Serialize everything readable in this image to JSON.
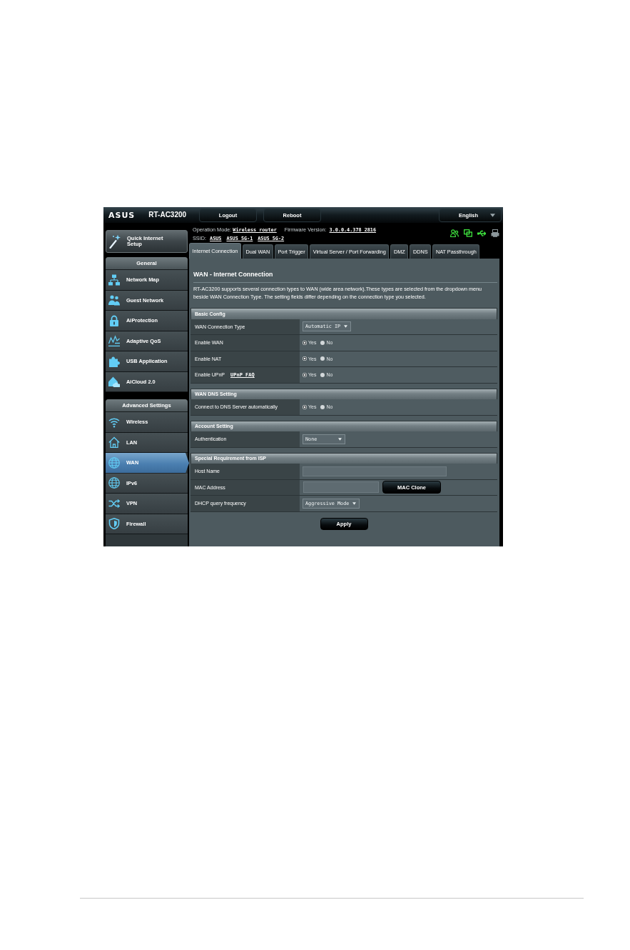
{
  "header": {
    "logo": "ASUS",
    "model": "RT-AC3200",
    "buttons": [
      "Logout",
      "Reboot"
    ],
    "language": "English"
  },
  "quick_setup": {
    "label": "Quick Internet Setup"
  },
  "status": {
    "operation_mode_label": "Operation Mode:",
    "operation_mode": "Wireless router",
    "firmware_label": "Firmware Version:",
    "firmware": "3.0.0.4.378_2816",
    "ssid_label": "SSID:",
    "ssids": [
      "ASUS",
      "ASUS_5G-1",
      "ASUS_5G-2"
    ],
    "icons": [
      {
        "kind": "clients",
        "on": true
      },
      {
        "kind": "network",
        "on": true
      },
      {
        "kind": "usb",
        "on": true
      },
      {
        "kind": "printer",
        "on": false
      }
    ]
  },
  "sidebar": {
    "sections": [
      {
        "title": "General",
        "items": [
          {
            "label": "Network Map",
            "selected": false
          },
          {
            "label": "Guest Network",
            "selected": false
          },
          {
            "label": "AiProtection",
            "selected": false
          },
          {
            "label": "Adaptive QoS",
            "selected": false
          },
          {
            "label": "USB Application",
            "selected": false
          },
          {
            "label": "AiCloud 2.0",
            "selected": false
          }
        ]
      },
      {
        "title": "Advanced Settings",
        "items": [
          {
            "label": "Wireless",
            "selected": false
          },
          {
            "label": "LAN",
            "selected": false
          },
          {
            "label": "WAN",
            "selected": true
          },
          {
            "label": "IPv6",
            "selected": false
          },
          {
            "label": "VPN",
            "selected": false
          },
          {
            "label": "Firewall",
            "selected": false
          }
        ]
      }
    ]
  },
  "tabs": [
    {
      "label": "Internet Connection",
      "selected": true
    },
    {
      "label": "Dual WAN",
      "selected": false
    },
    {
      "label": "Port Trigger",
      "selected": false
    },
    {
      "label": "Virtual Server / Port Forwarding",
      "selected": false
    },
    {
      "label": "DMZ",
      "selected": false
    },
    {
      "label": "DDNS",
      "selected": false
    },
    {
      "label": "NAT Passthrough",
      "selected": false
    }
  ],
  "content": {
    "title": "WAN - Internet Connection",
    "description": "RT-AC3200 supports several connection types to WAN (wide area network).These types are selected from the dropdown menu beside WAN Connection Type. The setting fields differ depending on the connection type you selected.",
    "sections": [
      {
        "title": "Basic Config",
        "rows": [
          {
            "kind": "select",
            "label": "WAN Connection Type",
            "value": "Automatic IP"
          },
          {
            "kind": "radio",
            "label": "Enable WAN",
            "options": [
              {
                "label": "Yes",
                "selected": true
              },
              {
                "label": "No",
                "selected": false
              }
            ]
          },
          {
            "kind": "radio",
            "label": "Enable NAT",
            "options": [
              {
                "label": "Yes",
                "selected": true
              },
              {
                "label": "No",
                "selected": false
              }
            ]
          },
          {
            "kind": "radio",
            "label": "Enable UPnP",
            "link": "UPnP FAQ",
            "options": [
              {
                "label": "Yes",
                "selected": true
              },
              {
                "label": "No",
                "selected": false
              }
            ]
          }
        ]
      },
      {
        "title": "WAN DNS Setting",
        "rows": [
          {
            "kind": "radio",
            "label": "Connect to DNS Server automatically",
            "options": [
              {
                "label": "Yes",
                "selected": true
              },
              {
                "label": "No",
                "selected": false
              }
            ]
          }
        ]
      },
      {
        "title": "Account Setting",
        "rows": [
          {
            "kind": "select",
            "label": "Authentication",
            "value": "None"
          }
        ]
      },
      {
        "title": "Special Requirement from ISP",
        "rows": [
          {
            "kind": "input",
            "label": "Host Name"
          },
          {
            "kind": "input",
            "label": "MAC Address",
            "button": "MAC Clone"
          },
          {
            "kind": "select",
            "label": "DHCP query frequency",
            "value": "Aggressive Mode"
          }
        ]
      }
    ],
    "apply_button": "Apply"
  }
}
